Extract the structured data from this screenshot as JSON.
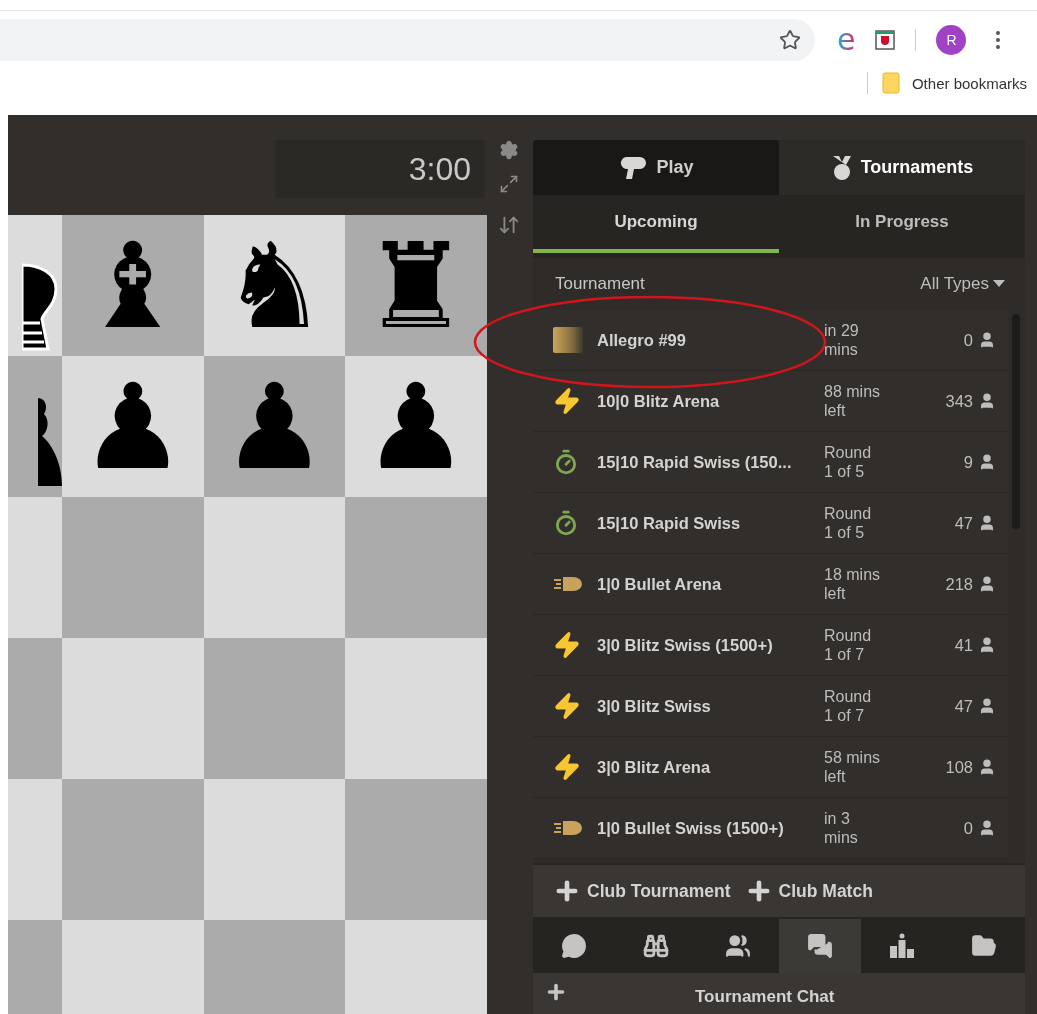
{
  "browser": {
    "extensions": [
      {
        "kind": "letter",
        "text": "e"
      },
      {
        "kind": "shield"
      }
    ],
    "avatar": "R",
    "bookmarks": [
      "Other bookmarks"
    ]
  },
  "clock": "3:00",
  "board": {
    "back_rank": [
      "♝",
      "♞",
      "♜"
    ],
    "pawn_rank": [
      "♟",
      "♟",
      "♟"
    ]
  },
  "tabs": [
    {
      "label": "Play",
      "kind": "play",
      "selected": false
    },
    {
      "label": "Tournaments",
      "kind": "medal",
      "selected": true
    }
  ],
  "subtabs": [
    {
      "label": "Upcoming",
      "selected": true
    },
    {
      "label": "In Progress",
      "selected": false
    }
  ],
  "list_header": {
    "column": "Tournament",
    "filter": "All Types"
  },
  "tournaments": [
    {
      "kind": "photo",
      "name": "Allegro #99",
      "time": "in 29 mins",
      "players": "0"
    },
    {
      "kind": "blitz",
      "name": "10|0 Blitz Arena",
      "time": "88 mins left",
      "players": "343"
    },
    {
      "kind": "rapid",
      "name": "15|10 Rapid Swiss (150...",
      "time": "Round 1 of 5",
      "players": "9"
    },
    {
      "kind": "rapid",
      "name": "15|10 Rapid Swiss",
      "time": "Round 1 of 5",
      "players": "47"
    },
    {
      "kind": "bullet",
      "name": "1|0 Bullet Arena",
      "time": "18 mins left",
      "players": "218"
    },
    {
      "kind": "blitz",
      "name": "3|0 Blitz Swiss (1500+)",
      "time": "Round 1 of 7",
      "players": "41"
    },
    {
      "kind": "blitz",
      "name": "3|0 Blitz Swiss",
      "time": "Round 1 of 7",
      "players": "47"
    },
    {
      "kind": "blitz",
      "name": "3|0 Blitz Arena",
      "time": "58 mins left",
      "players": "108"
    },
    {
      "kind": "bullet",
      "name": "1|0 Bullet Swiss (1500+)",
      "time": "in 3 mins",
      "players": "0"
    }
  ],
  "create_links": [
    "Club Tournament",
    "Club Match"
  ],
  "bottom_tabs": [
    {
      "kind": "chat",
      "selected": false
    },
    {
      "kind": "binoculars",
      "selected": false
    },
    {
      "kind": "people",
      "selected": false
    },
    {
      "kind": "chats",
      "selected": true
    },
    {
      "kind": "podium",
      "selected": false
    },
    {
      "kind": "folder",
      "selected": false
    }
  ],
  "chat": {
    "title": "Tournament Chat"
  }
}
